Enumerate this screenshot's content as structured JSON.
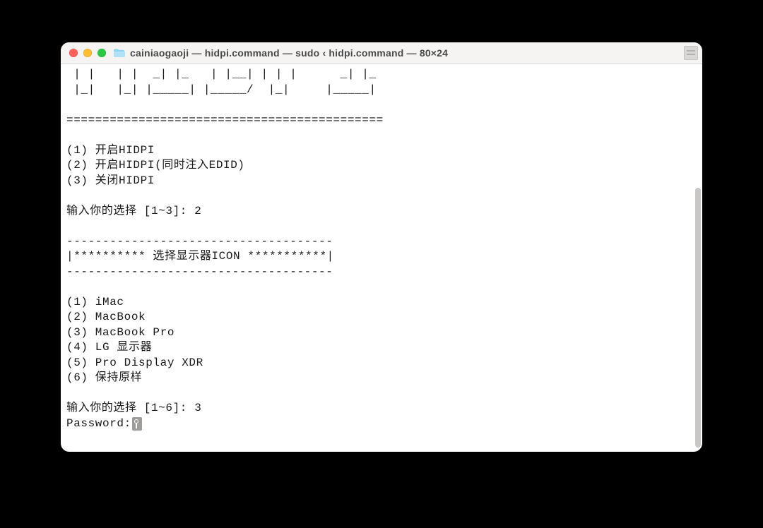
{
  "window": {
    "title": "cainiaogaoji — hidpi.command — sudo ‹ hidpi.command — 80×24"
  },
  "ascii_art": [
    " | |   | |  _| |_   | |__| | | |      _| |_ ",
    " |_|   |_| |_____| |_____/  |_|     |_____|"
  ],
  "divider_eq": "============================================",
  "menu1": {
    "items": [
      "(1) 开启HIDPI",
      "(2) 开启HIDPI(同时注入EDID)",
      "(3) 关闭HIDPI"
    ],
    "prompt": "输入你的选择 [1~3]: 2"
  },
  "section": {
    "dash_top": "-------------------------------------",
    "title_line": "|********** 选择显示器ICON ***********|",
    "dash_bottom": "-------------------------------------"
  },
  "menu2": {
    "items": [
      "(1) iMac",
      "(2) MacBook",
      "(3) MacBook Pro",
      "(4) LG 显示器",
      "(5) Pro Display XDR",
      "(6) 保持原样"
    ],
    "prompt": "输入你的选择 [1~6]: 3"
  },
  "password_label": "Password:"
}
